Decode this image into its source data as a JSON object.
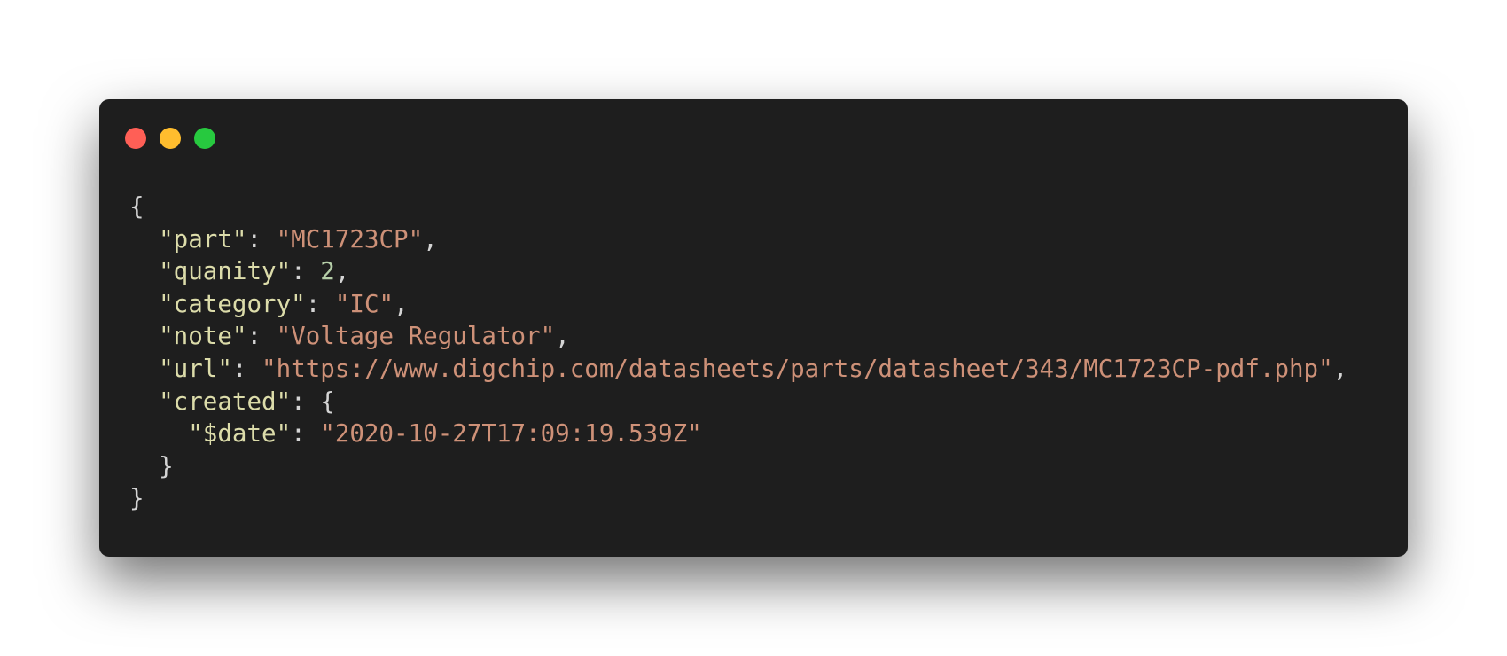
{
  "window": {
    "controls": [
      "close-icon",
      "minimize-icon",
      "zoom-icon"
    ],
    "colors": {
      "background": "#1e1e1e",
      "close": "#ff5f56",
      "minimize": "#ffbd2e",
      "zoom": "#27c93f",
      "key": "#dcdcaa",
      "string": "#ce9178",
      "number": "#b5cea8",
      "punctuation": "#d4d4d4"
    }
  },
  "code": {
    "open_brace": "{",
    "close_brace": "}",
    "lines": {
      "part": {
        "key": "\"part\"",
        "value": "\"MC1723CP\""
      },
      "quanity": {
        "key": "\"quanity\"",
        "value": "2"
      },
      "category": {
        "key": "\"category\"",
        "value": "\"IC\""
      },
      "note": {
        "key": "\"note\"",
        "value": "\"Voltage Regulator\""
      },
      "url": {
        "key": "\"url\"",
        "value": "\"https://www.digchip.com/datasheets/parts/datasheet/343/MC1723CP-pdf.php\""
      },
      "created": {
        "key": "\"created\"",
        "open": "{",
        "date_key": "\"$date\"",
        "date_value": "\"2020-10-27T17:09:19.539Z\"",
        "close": "}"
      }
    }
  }
}
